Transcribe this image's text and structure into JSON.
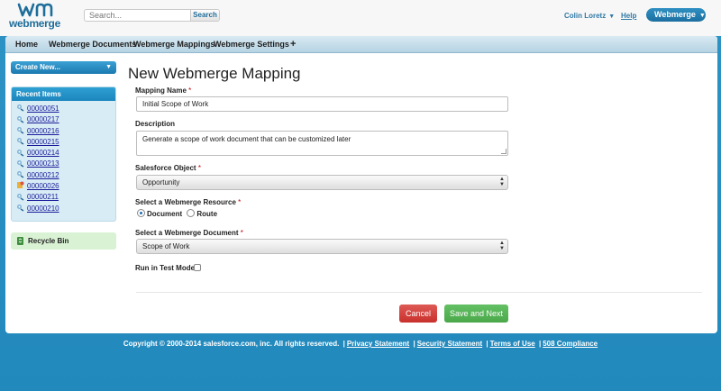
{
  "header": {
    "logo_text": "webmerge",
    "search": {
      "placeholder": "Search...",
      "button_label": "Search"
    },
    "user_name": "Colin Loretz",
    "help_label": "Help",
    "app_switcher_label": "Webmerge"
  },
  "tabs": [
    {
      "label": "Home"
    },
    {
      "label": "Webmerge Documents"
    },
    {
      "label": "Webmerge Mappings"
    },
    {
      "label": "Webmerge Settings"
    },
    {
      "label": "+"
    }
  ],
  "sidebar": {
    "create_new_label": "Create New...",
    "recent_items_title": "Recent Items",
    "recent_items": [
      {
        "label": "00000051",
        "icon": "mapping-icon"
      },
      {
        "label": "00000217",
        "icon": "mapping-icon"
      },
      {
        "label": "00000216",
        "icon": "mapping-icon"
      },
      {
        "label": "00000215",
        "icon": "mapping-icon"
      },
      {
        "label": "00000214",
        "icon": "mapping-icon"
      },
      {
        "label": "00000213",
        "icon": "mapping-icon"
      },
      {
        "label": "00000212",
        "icon": "mapping-icon"
      },
      {
        "label": "00000026",
        "icon": "document-icon"
      },
      {
        "label": "00000211",
        "icon": "mapping-icon"
      },
      {
        "label": "00000210",
        "icon": "mapping-icon"
      }
    ],
    "recycle_bin_label": "Recycle Bin"
  },
  "form": {
    "title": "New Webmerge Mapping",
    "mapping_name": {
      "label": "Mapping Name",
      "required": "*",
      "value": "Initial Scope of Work"
    },
    "description": {
      "label": "Description",
      "value": "Generate a scope of work document that can be customized later"
    },
    "salesforce_object": {
      "label": "Salesforce Object",
      "required": "*",
      "value": "Opportunity"
    },
    "resource": {
      "label": "Select a Webmerge Resource",
      "required": "*",
      "options": [
        "Document",
        "Route"
      ],
      "selected": "Document"
    },
    "document": {
      "label": "Select a Webmerge Document",
      "required": "*",
      "value": "Scope of Work"
    },
    "test_mode": {
      "label": "Run in Test Mode?",
      "checked": false
    },
    "cancel_label": "Cancel",
    "save_label": "Save and Next"
  },
  "colors": {
    "brand_blue": "#2289bd",
    "cancel_red": "#c9302c",
    "save_green": "#4aa84a"
  },
  "footer": {
    "copyright": "Copyright © 2000-2014 salesforce.com, inc. All rights reserved.",
    "links": [
      "Privacy Statement",
      "Security Statement",
      "Terms of Use",
      "508 Compliance"
    ]
  }
}
